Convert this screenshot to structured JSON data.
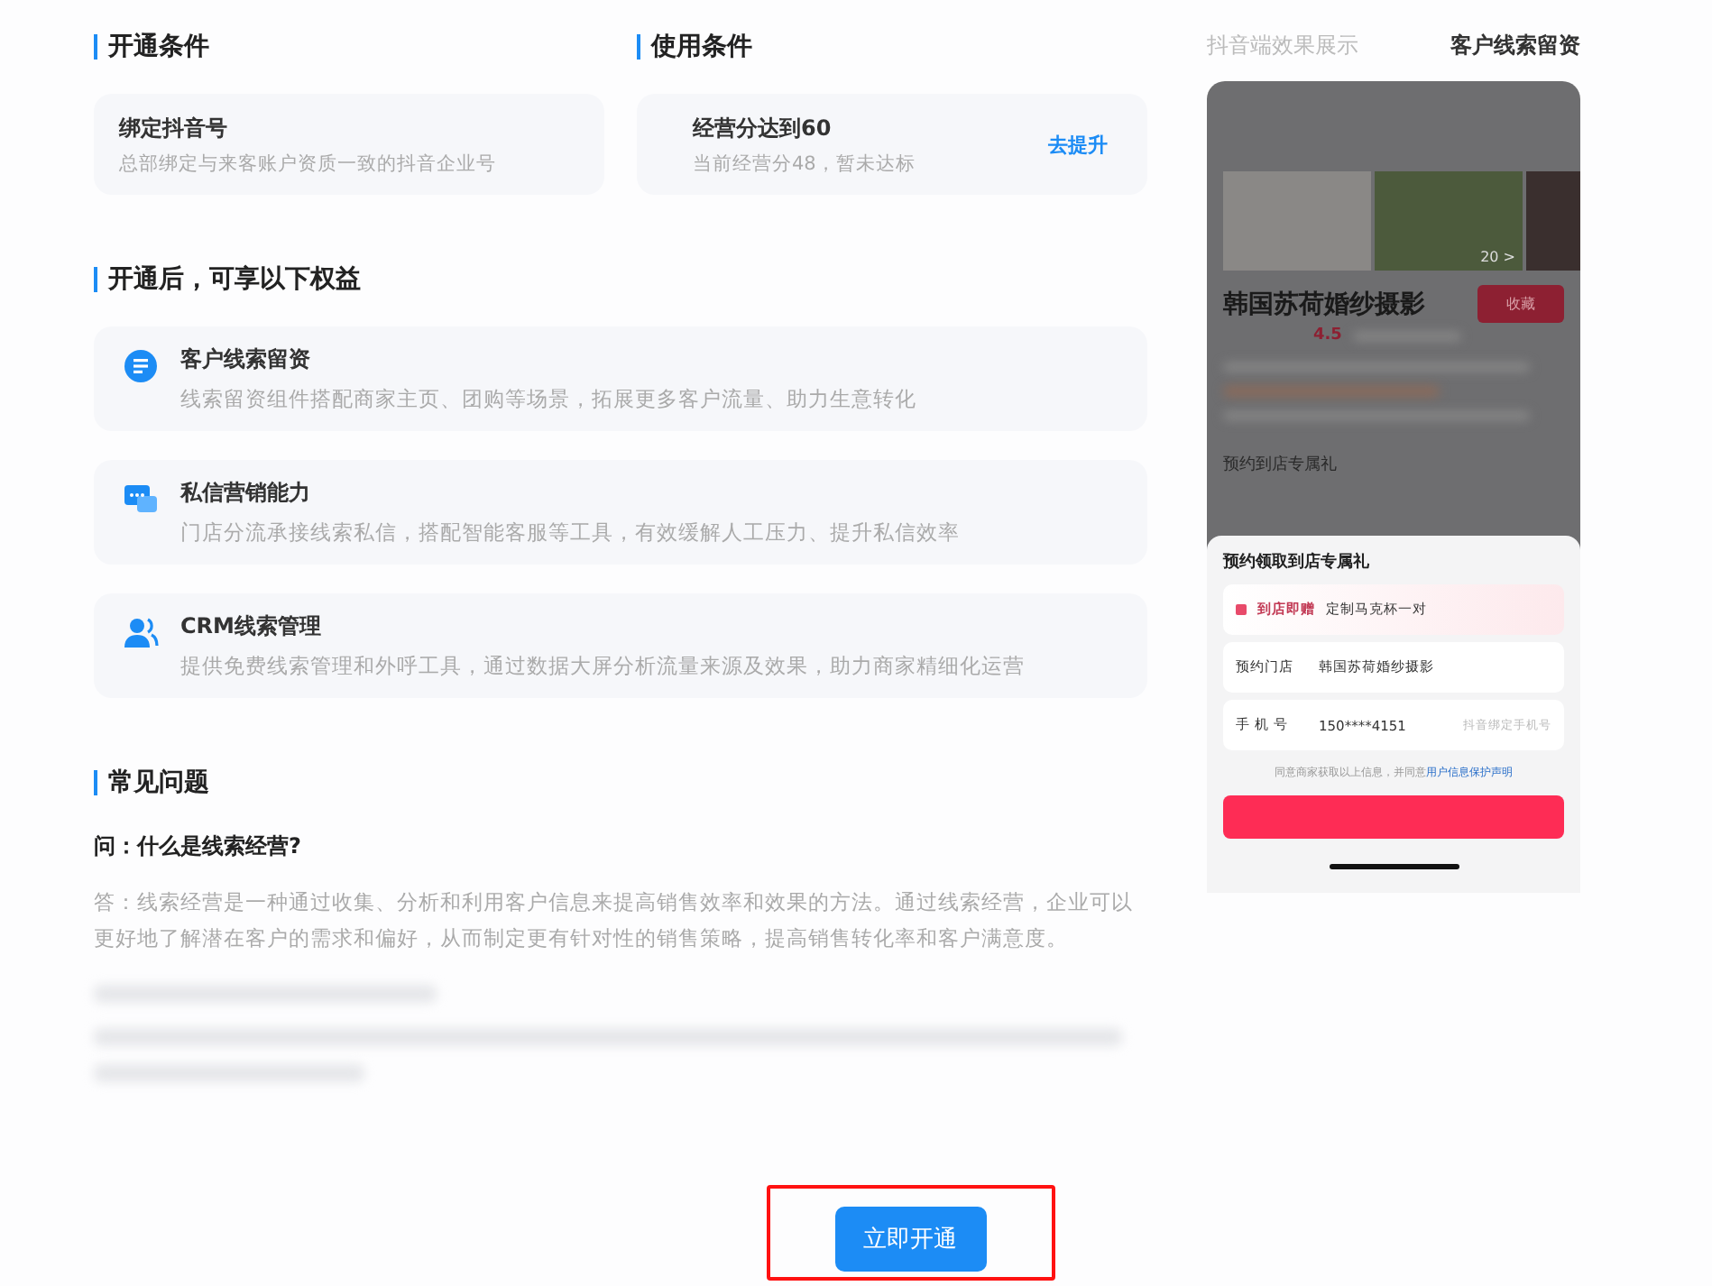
{
  "conditions": [
    {
      "title": "开通条件",
      "card": {
        "name": "绑定抖音号",
        "desc": "总部绑定与来客账户资质一致的抖音企业号"
      }
    },
    {
      "title": "使用条件",
      "card": {
        "name": "经营分达到60",
        "desc": "当前经营分48，暂未达标",
        "link": "去提升"
      }
    }
  ],
  "benefits": {
    "title": "开通后，可享以下权益",
    "items": [
      {
        "kind": "form",
        "name": "客户线索留资",
        "desc": "线索留资组件搭配商家主页、团购等场景，拓展更多客户流量、助力生意转化"
      },
      {
        "kind": "chat",
        "name": "私信营销能力",
        "desc": "门店分流承接线索私信，搭配智能客服等工具，有效缓解人工压力、提升私信效率"
      },
      {
        "kind": "people",
        "name": "CRM线索管理",
        "desc": "提供免费线索管理和外呼工具，通过数据大屏分析流量来源及效果，助力商家精细化运营"
      }
    ]
  },
  "faq": {
    "title": "常见问题",
    "question": "问：什么是线索经营?",
    "answer": "答：线索经营是一种通过收集、分析和利用客户信息来提高销售效率和效果的方法。通过线索经营，企业可以更好地了解潜在客户的需求和偏好，从而制定更有针对性的销售策略，提高销售转化率和客户满意度。"
  },
  "preview": {
    "tabs": [
      {
        "label": "抖音端效果展示",
        "selected": false
      },
      {
        "label": "客户线索留资",
        "selected": true
      }
    ],
    "phone": {
      "photo_count": "20 >",
      "shop_name": "韩国苏荷婚纱摄影",
      "collect": "收藏",
      "rating": "4.5",
      "gift_title": "预约到店专属礼",
      "sheet": {
        "title": "预约领取到店专属礼",
        "gift_tag": "到店即赠",
        "gift": "定制马克杯一对",
        "rows": [
          {
            "label": "预约门店",
            "value": "韩国苏荷婚纱摄影"
          },
          {
            "label": "手 机 号",
            "value": "150****4151",
            "hint": "抖音绑定手机号"
          }
        ],
        "consent": "同意商家获取以上信息，并同意",
        "consent_link": "用户信息保护声明"
      }
    }
  },
  "primary_button": {
    "label": "立即开通",
    "highlighted": true
  }
}
